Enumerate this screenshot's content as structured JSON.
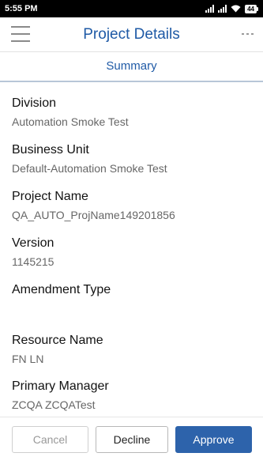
{
  "status_bar": {
    "time": "5:55 PM",
    "battery": "44"
  },
  "header": {
    "title": "Project Details",
    "menu_icon": "hamburger-icon",
    "more_icon": "more-dots-icon"
  },
  "tab": {
    "label": "Summary"
  },
  "fields": [
    {
      "label": "Division",
      "value": "Automation Smoke Test"
    },
    {
      "label": "Business Unit",
      "value": "Default-Automation Smoke Test"
    },
    {
      "label": "Project Name",
      "value": "QA_AUTO_ProjName149201856"
    },
    {
      "label": "Version",
      "value": "1145215"
    },
    {
      "label": "Amendment Type",
      "value": ""
    },
    {
      "label": "Resource Name",
      "value": "FN LN"
    },
    {
      "label": "Primary Manager",
      "value": "ZCQA ZCQATest"
    }
  ],
  "actions": {
    "cancel": "Cancel",
    "decline": "Decline",
    "approve": "Approve"
  },
  "colors": {
    "accent": "#1f5aa6",
    "approve_bg": "#2d63ab"
  }
}
